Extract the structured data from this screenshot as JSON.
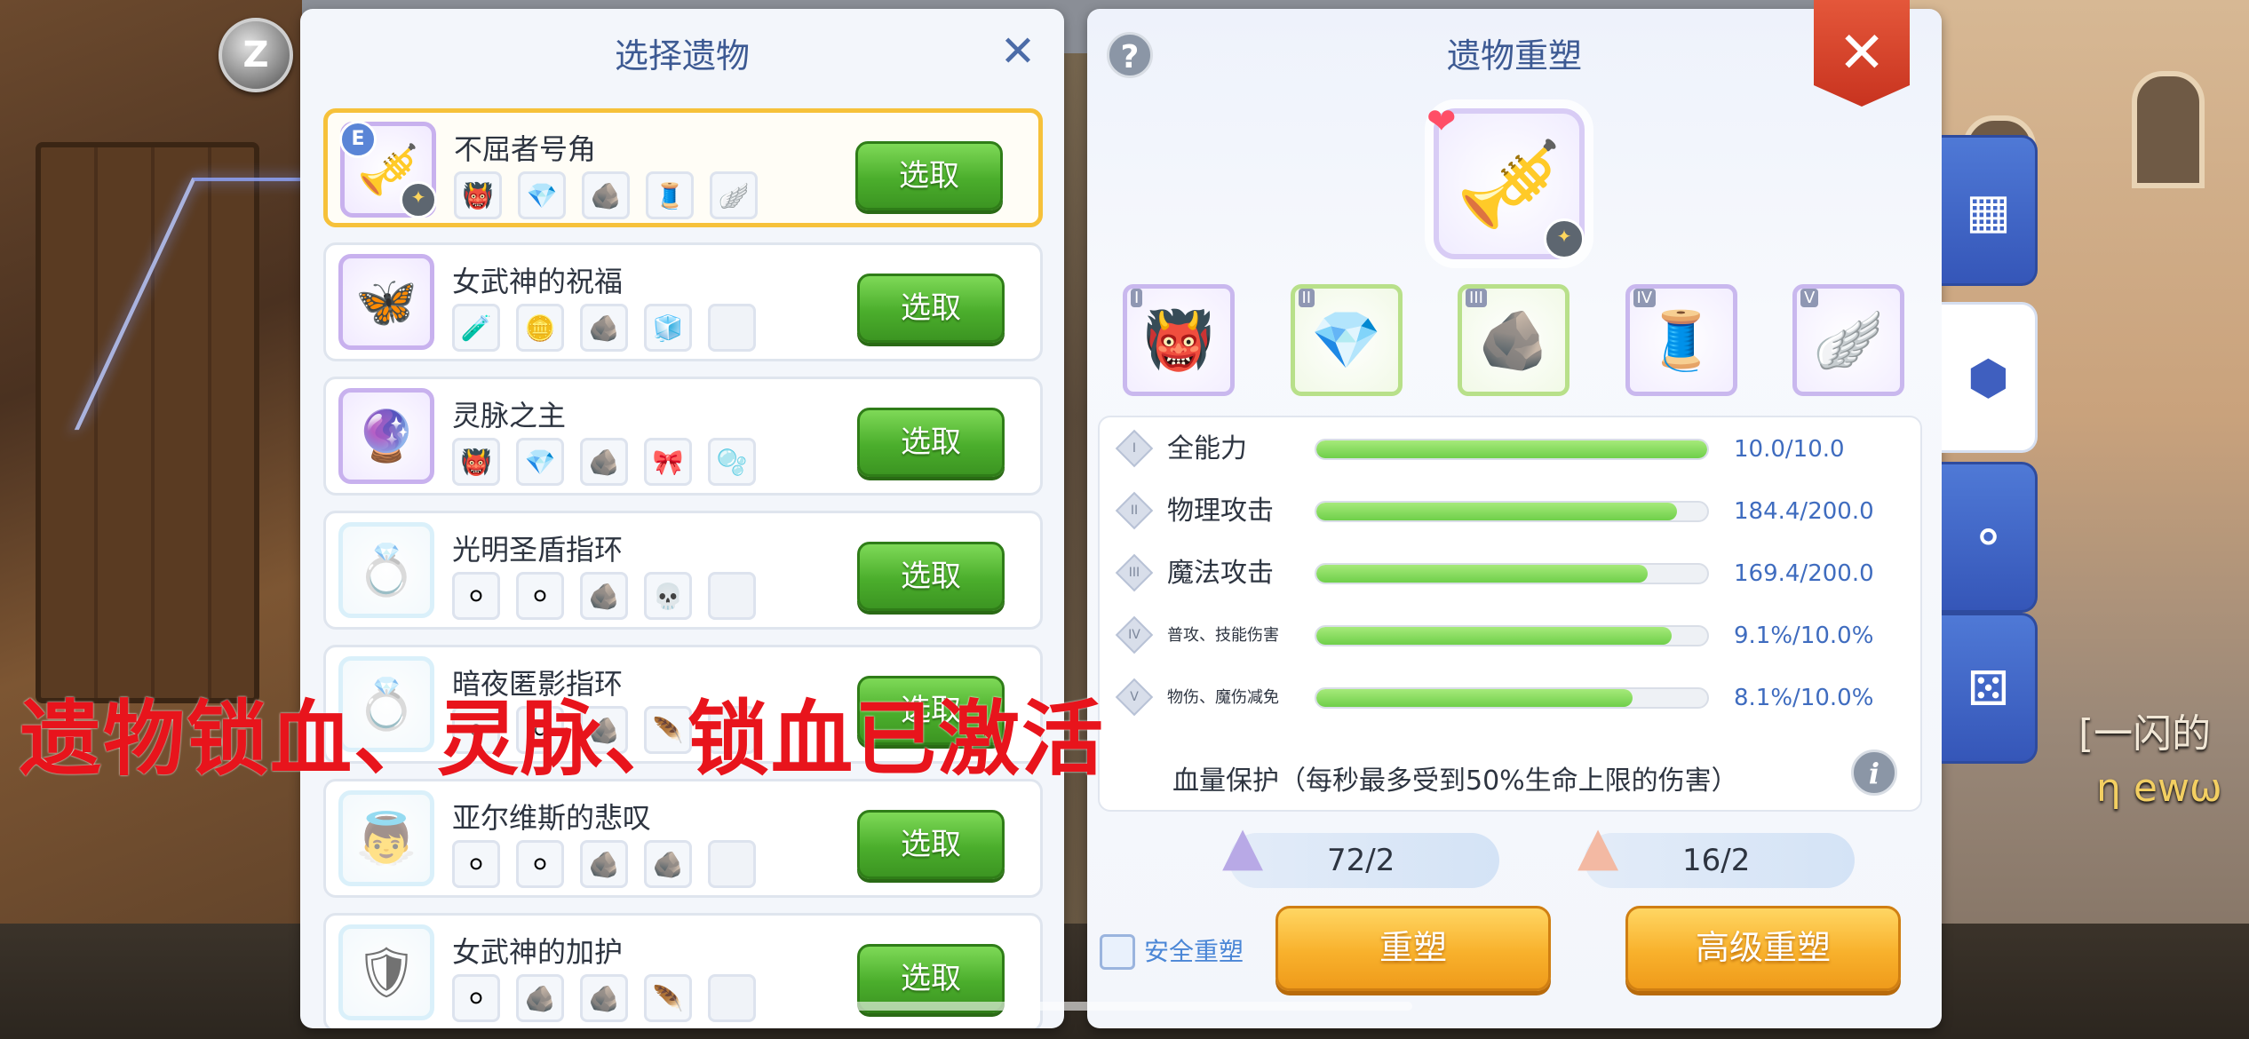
{
  "chat": {
    "right_line1": "[一闪的",
    "right_line2": "η ewω"
  },
  "z_button": {
    "label": "Z"
  },
  "left_panel": {
    "title": "选择遗物",
    "relics": [
      {
        "name": "不屈者号角",
        "icon": "🎺",
        "selected": true,
        "badge": "E",
        "slots": [
          "👹",
          "💎",
          "🪨",
          "🧵",
          "🪽"
        ],
        "button": "选取"
      },
      {
        "name": "女武神的祝福",
        "icon": "🦋",
        "selected": false,
        "slots": [
          "🧪",
          "🪙",
          "🪨",
          "🧊",
          ""
        ],
        "button": "选取"
      },
      {
        "name": "灵脉之主",
        "icon": "🔮",
        "selected": false,
        "slots": [
          "👹",
          "💎",
          "🪨",
          "🎀",
          "🫧"
        ],
        "button": "选取"
      },
      {
        "name": "光明圣盾指环",
        "icon": "💍",
        "selected": false,
        "slots": [
          "⚪",
          "⚪",
          "🪨",
          "💀",
          ""
        ],
        "button": "选取"
      },
      {
        "name": "暗夜匿影指环",
        "icon": "💍",
        "selected": false,
        "slots": [
          "⚪",
          "⚪",
          "🪨",
          "🪶",
          ""
        ],
        "button": "选取"
      },
      {
        "name": "亚尔维斯的悲叹",
        "icon": "👼",
        "selected": false,
        "slots": [
          "⚪",
          "⚪",
          "🪨",
          "🪨",
          ""
        ],
        "button": "选取"
      },
      {
        "name": "女武神的加护",
        "icon": "🛡",
        "selected": false,
        "slots": [
          "⚪",
          "🪨",
          "🪨",
          "🪶",
          ""
        ],
        "button": "选取"
      }
    ]
  },
  "overlay_text": "遗物锁血、灵脉、锁血已激活",
  "right_panel": {
    "title": "遗物重塑",
    "help": "?",
    "hero_icon": "🎺",
    "parts": [
      {
        "roman": "I",
        "icon": "👹",
        "style": "purple"
      },
      {
        "roman": "II",
        "icon": "💎",
        "style": "green"
      },
      {
        "roman": "III",
        "icon": "🪨",
        "style": "green"
      },
      {
        "roman": "IV",
        "icon": "🧵",
        "style": "purple"
      },
      {
        "roman": "V",
        "icon": "🪽",
        "style": "purple"
      }
    ],
    "stats": [
      {
        "roman": "I",
        "label": "全能力",
        "value": "10.0/10.0",
        "fill": 1.0,
        "small": false
      },
      {
        "roman": "II",
        "label": "物理攻击",
        "value": "184.4/200.0",
        "fill": 0.922,
        "small": false
      },
      {
        "roman": "III",
        "label": "魔法攻击",
        "value": "169.4/200.0",
        "fill": 0.847,
        "small": false
      },
      {
        "roman": "IV",
        "label": "普攻、技能伤害",
        "value": "9.1%/10.0%",
        "fill": 0.91,
        "small": true
      },
      {
        "roman": "V",
        "label": "物伤、魔伤减免",
        "value": "8.1%/10.0%",
        "fill": 0.81,
        "small": true
      }
    ],
    "hp_protect": "血量保护（每秒最多受到50%生命上限的伤害）",
    "info": "i",
    "materials": [
      {
        "count": "72/2",
        "color": "#b8a9e6"
      },
      {
        "count": "16/2",
        "color": "#f3b9a3"
      }
    ],
    "safe_reforge": "安全重塑",
    "reforge_button": "重塑",
    "advanced_reforge_button": "高级重塑"
  },
  "close_button": "✕",
  "side_tabs": [
    {
      "icon": "▦",
      "name": "shop-icon",
      "active": false
    },
    {
      "icon": "⬢",
      "name": "relic-icon",
      "active": true
    },
    {
      "icon": "⚬",
      "name": "link-icon",
      "active": false
    },
    {
      "icon": "⚄",
      "name": "dice-icon",
      "active": false
    }
  ]
}
